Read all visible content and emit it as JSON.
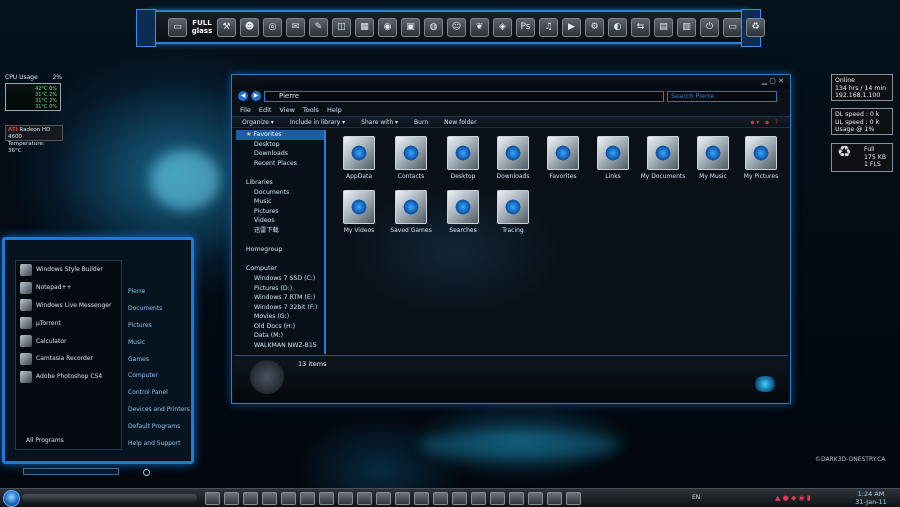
{
  "dock": {
    "fullglass": "FULL glass"
  },
  "cpu_gadget": {
    "title": "CPU Usage",
    "value": "2%",
    "cores": [
      {
        "label": "42°C",
        "pct": "0%"
      },
      {
        "label": "31°C",
        "pct": "2%"
      },
      {
        "label": "31°C",
        "pct": "2%"
      },
      {
        "label": "31°C",
        "pct": "0%"
      }
    ]
  },
  "ati_gadget": {
    "name": "Radeon HD 4600",
    "temp_label": "Temperature:",
    "temp": "36°C"
  },
  "net_gadget": {
    "line1": "Online",
    "line2": "134 hrs / 14 min",
    "line3": "192.168.1.100"
  },
  "speed_gadget": {
    "dl": "DL speed : 0 k",
    "ul": "UL speed : 0 k",
    "usage": "Usage @ 1%"
  },
  "bin_gadget": {
    "state": "Full",
    "size": "175 KB",
    "files": "1 FLS"
  },
  "explorer": {
    "address": "Pierre",
    "search_placeholder": "Search Pierre",
    "menu": [
      "File",
      "Edit",
      "View",
      "Tools",
      "Help"
    ],
    "commands": [
      "Organize ▾",
      "Include in library ▾",
      "Share with ▾",
      "Burn",
      "New folder"
    ],
    "nav": {
      "favorites": "Favorites",
      "fav_items": [
        "Desktop",
        "Downloads",
        "Recent Places"
      ],
      "libraries": "Libraries",
      "lib_items": [
        "Documents",
        "Music",
        "Pictures",
        "Videos",
        "迅雷下载"
      ],
      "homegroup": "Homegroup",
      "computer": "Computer",
      "drives": [
        "Windows 7 SSD (C:)",
        "Pictures (D:)",
        "Windows 7 RTM (E:)",
        "Windows 7 32bit (F:)",
        "Movies (G:)",
        "Old Docs (H:)",
        "Data (M:)",
        "WALKMAN NWZ-B15"
      ]
    },
    "files": [
      "AppData",
      "Contacts",
      "Desktop",
      "Downloads",
      "Favorites",
      "Links",
      "My Documents",
      "My Music",
      "My Pictures",
      "My Videos",
      "Saved Games",
      "Searches",
      "Tracing"
    ],
    "status": "13 items"
  },
  "startmenu": {
    "items": [
      "Windows Style Builder",
      "Notepad++",
      "Windows Live Messenger",
      "µTorrent",
      "Calculator",
      "Camtasia Recorder",
      "Adobe Photoshop CS4"
    ],
    "all_programs": "All Programs",
    "right": [
      "Pierre",
      "Documents",
      "Pictures",
      "Music",
      "Games",
      "Computer",
      "Control Panel",
      "Devices and Printers",
      "Default Programs",
      "Help and Support"
    ]
  },
  "watermark": "©DARK3D-ONESTRY.CA",
  "taskbar": {
    "lang": "EN",
    "time": "1:24 AM",
    "date": "31-Jan-11"
  }
}
